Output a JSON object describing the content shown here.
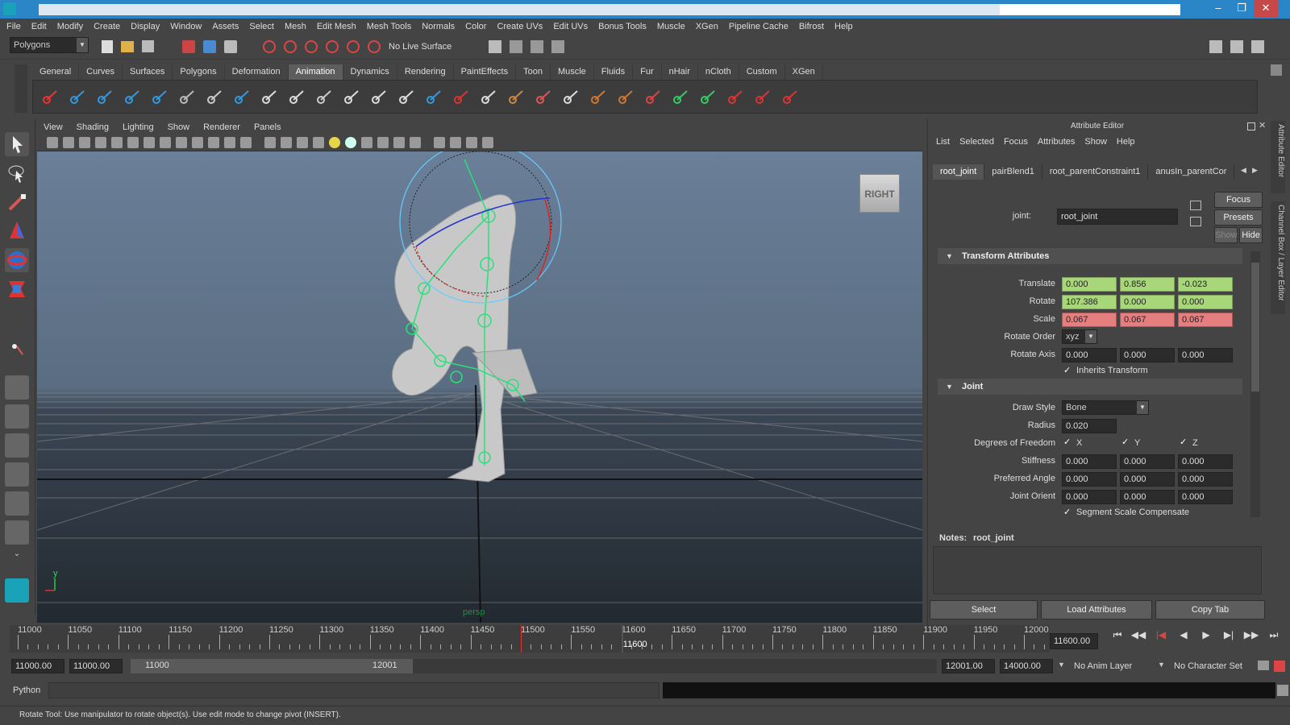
{
  "menubar": [
    "File",
    "Edit",
    "Modify",
    "Create",
    "Display",
    "Window",
    "Assets",
    "Select",
    "Mesh",
    "Edit Mesh",
    "Mesh Tools",
    "Normals",
    "Color",
    "Create UVs",
    "Edit UVs",
    "Bonus Tools",
    "Muscle",
    "XGen",
    "Pipeline Cache",
    "Bifrost",
    "Help"
  ],
  "status": {
    "mode": "Polygons",
    "live_surface": "No Live Surface"
  },
  "shelf_tabs": [
    "General",
    "Curves",
    "Surfaces",
    "Polygons",
    "Deformation",
    "Animation",
    "Dynamics",
    "Rendering",
    "PaintEffects",
    "Toon",
    "Muscle",
    "Fluids",
    "Fur",
    "nHair",
    "nCloth",
    "Custom",
    "XGen"
  ],
  "shelf_active": "Animation",
  "viewport": {
    "menu": [
      "View",
      "Shading",
      "Lighting",
      "Show",
      "Renderer",
      "Panels"
    ],
    "view_cube_label": "RIGHT",
    "camera_label": "persp",
    "axis_label": "y"
  },
  "attribute_editor": {
    "title": "Attribute Editor",
    "menu": [
      "List",
      "Selected",
      "Focus",
      "Attributes",
      "Show",
      "Help"
    ],
    "tabs": [
      "root_joint",
      "pairBlend1",
      "root_parentConstraint1",
      "anusIn_parentCor"
    ],
    "node_label": "joint:",
    "node_name": "root_joint",
    "buttons": {
      "focus": "Focus",
      "presets": "Presets",
      "show": "Show",
      "hide": "Hide"
    },
    "transform": {
      "header": "Transform Attributes",
      "translate_label": "Translate",
      "translate": [
        "0.000",
        "0.856",
        "-0.023"
      ],
      "rotate_label": "Rotate",
      "rotate": [
        "107.386",
        "0.000",
        "0.000"
      ],
      "scale_label": "Scale",
      "scale": [
        "0.067",
        "0.067",
        "0.067"
      ],
      "rotate_order_label": "Rotate Order",
      "rotate_order": "xyz",
      "rotate_axis_label": "Rotate Axis",
      "rotate_axis": [
        "0.000",
        "0.000",
        "0.000"
      ],
      "inherits_label": "Inherits Transform"
    },
    "joint": {
      "header": "Joint",
      "draw_style_label": "Draw Style",
      "draw_style": "Bone",
      "radius_label": "Radius",
      "radius": "0.020",
      "dof_label": "Degrees of Freedom",
      "dof": [
        "X",
        "Y",
        "Z"
      ],
      "stiffness_label": "Stiffness",
      "stiffness": [
        "0.000",
        "0.000",
        "0.000"
      ],
      "preferred_label": "Preferred Angle",
      "preferred": [
        "0.000",
        "0.000",
        "0.000"
      ],
      "orient_label": "Joint Orient",
      "orient": [
        "0.000",
        "0.000",
        "0.000"
      ],
      "ssc_label": "Segment Scale Compensate"
    },
    "notes_label": "Notes:",
    "notes_node": "root_joint",
    "bottom_buttons": [
      "Select",
      "Load Attributes",
      "Copy Tab"
    ]
  },
  "timeline": {
    "labels": [
      "11000",
      "11050",
      "11100",
      "11150",
      "11200",
      "11250",
      "11300",
      "11350",
      "11400",
      "11450",
      "11500",
      "11550",
      "11600",
      "11650",
      "11700",
      "11750",
      "11800",
      "11850",
      "11900",
      "11950",
      "12000"
    ],
    "current_frame_label": "11600",
    "current_frame_field": "11600.00"
  },
  "range": {
    "start": "11000.00",
    "inner_start": "11000.00",
    "slider_start": "11000",
    "slider_end": "12001",
    "inner_end": "12001.00",
    "end": "14000.00",
    "anim_layer": "No Anim Layer",
    "char_set": "No Character Set"
  },
  "cmdline": {
    "lang": "Python"
  },
  "help_text": "Rotate Tool: Use manipulator to rotate object(s). Use edit mode to change pivot (INSERT).",
  "side_tabs": [
    "Attribute Editor",
    "Channel Box / Layer Editor"
  ]
}
